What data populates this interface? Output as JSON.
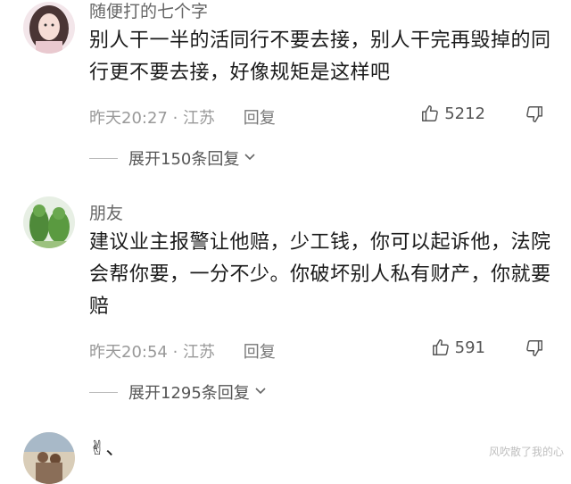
{
  "comments": [
    {
      "username": "随便打的七个字",
      "text": "别人干一半的活同行不要去接，别人干完再毁掉的同行更不要去接，好像规矩是这样吧",
      "time": "昨天20:27",
      "location": "江苏",
      "reply_label": "回复",
      "likes": "5212",
      "expand_label": "展开150条回复"
    },
    {
      "username": "朋友",
      "text": "建议业主报警让他赔，少工钱，你可以起诉他，法院会帮你要，一分不少。你破坏别人私有财产，你就要赔",
      "time": "昨天20:54",
      "location": "江苏",
      "reply_label": "回复",
      "likes": "591",
      "expand_label": "展开1295条回复"
    },
    {
      "text": "✌、"
    }
  ],
  "separator": " · ",
  "watermark": "风吹散了我的心",
  "icons": {
    "like": "thumbs-up-icon",
    "dislike": "thumbs-down-icon",
    "expand": "chevron-down-icon"
  }
}
